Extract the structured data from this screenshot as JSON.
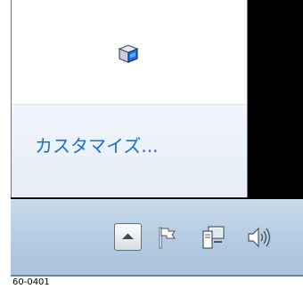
{
  "overflow_popup": {
    "icons": [
      {
        "name": "app-tray-icon"
      }
    ],
    "customize_label": "カスタマイズ..."
  },
  "taskbar": {
    "show_hidden_icons_button": {
      "icon": "chevron-up-icon"
    },
    "tray_icons": [
      {
        "icon": "action-center-flag-icon"
      },
      {
        "icon": "network-icon"
      },
      {
        "icon": "speaker-volume-icon"
      }
    ]
  },
  "caption": "60-0401"
}
